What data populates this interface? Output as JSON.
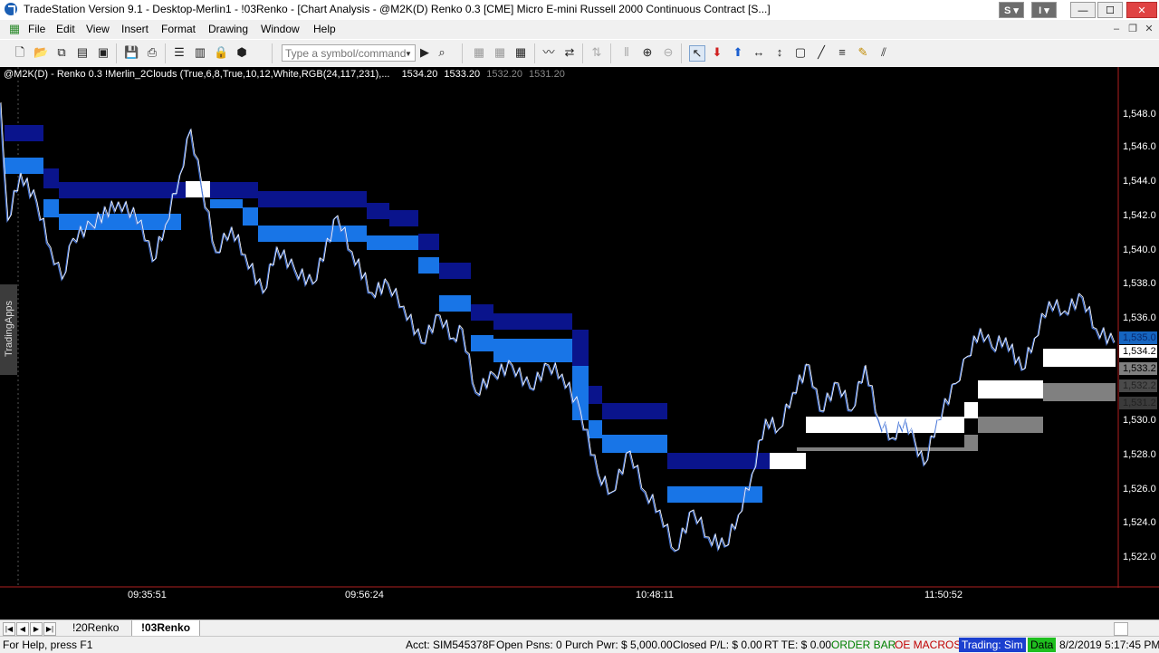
{
  "window": {
    "title": "TradeStation Version 9.1 - Desktop-Merlin1 - !03Renko - [Chart Analysis - @M2K(D) Renko 0.3 [CME] Micro E-mini Russell 2000 Continuous Contract [S...]",
    "badge_s": "S",
    "badge_i": "I"
  },
  "menu": [
    "File",
    "Edit",
    "View",
    "Insert",
    "Format",
    "Drawing",
    "Window",
    "Help"
  ],
  "toolbar": {
    "symbol_placeholder": "Type a symbol/command"
  },
  "chart": {
    "legend": "@M2K(D) - Renko 0.3  !Merlin_2Clouds (True,6,8,True,10,12,White,RGB(24,117,231),...",
    "legend_values": [
      "1534.20",
      "1533.20"
    ],
    "legend_values_dim": [
      "1532.20",
      "1531.20"
    ],
    "side_tab": "TradingApps",
    "y_ticks": [
      "1,548.0",
      "1,546.0",
      "1,544.0",
      "1,542.0",
      "1,540.0",
      "1,538.0",
      "1,536.0",
      "1,530.0",
      "1,528.0",
      "1,526.0",
      "1,524.0",
      "1,522.0"
    ],
    "price_tags": [
      {
        "label": "1,535.0",
        "bg": "#1565c0",
        "fg": "#0b2a6e"
      },
      {
        "label": "1,534.2",
        "bg": "#ffffff",
        "fg": "#000000"
      },
      {
        "label": "1,533.2",
        "bg": "#808080",
        "fg": "#000000"
      },
      {
        "label": "1,532.2",
        "bg": "#4a4a4a",
        "fg": "#222222"
      },
      {
        "label": "1,531.2",
        "bg": "#3a3a3a",
        "fg": "#222222"
      }
    ],
    "x_ticks": [
      "09:35:51",
      "09:56:24",
      "10:48:11",
      "11:50:52"
    ]
  },
  "tabs": [
    "!20Renko",
    "!03Renko"
  ],
  "status": {
    "help": "For Help, press F1",
    "acct": "Acct: SIM545378F",
    "open_psns": "Open Psns: 0",
    "purch_pwr": "Purch Pwr: $ 5,000.00",
    "closed_pl": "Closed P/L: $ 0.00",
    "rt_te": "RT TE: $ 0.00",
    "order_bar": "ORDER BAR",
    "oe_macros": "OE MACROS",
    "trading": "Trading: Sim",
    "data": "Data",
    "datetime": "8/2/2019 5:17:45 PM"
  },
  "colors": {
    "cloud_dark": "#0a148c",
    "cloud_light": "#1875e7",
    "cloud_white": "#ffffff",
    "cloud_gray": "#808080",
    "price_line": "#ffffff",
    "price_line_down": "#4a78d8"
  }
}
